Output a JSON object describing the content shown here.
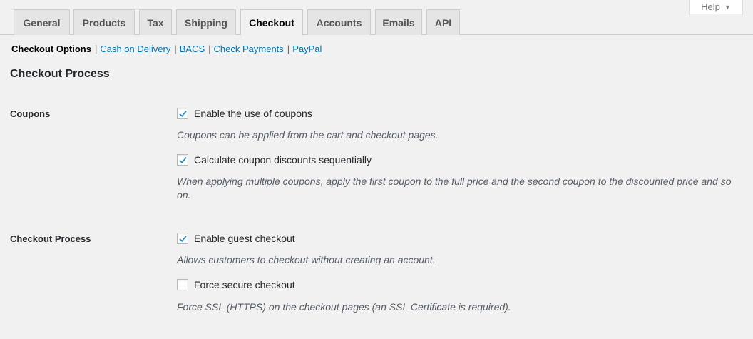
{
  "help": {
    "label": "Help",
    "caret": "▼"
  },
  "tabs": [
    {
      "label": "General"
    },
    {
      "label": "Products"
    },
    {
      "label": "Tax"
    },
    {
      "label": "Shipping"
    },
    {
      "label": "Checkout",
      "active": true
    },
    {
      "label": "Accounts"
    },
    {
      "label": "Emails"
    },
    {
      "label": "API"
    }
  ],
  "subnav": {
    "current": "Checkout Options",
    "links": [
      "Cash on Delivery",
      "BACS",
      "Check Payments",
      "PayPal"
    ],
    "separator": "|"
  },
  "section_title": "Checkout Process",
  "coupons": {
    "label": "Coupons",
    "options": [
      {
        "label": "Enable the use of coupons",
        "checked": true,
        "description": "Coupons can be applied from the cart and checkout pages."
      },
      {
        "label": "Calculate coupon discounts sequentially",
        "checked": true,
        "description": "When applying multiple coupons, apply the first coupon to the full price and the second coupon to the discounted price and so on."
      }
    ]
  },
  "checkout_process": {
    "label": "Checkout Process",
    "options": [
      {
        "label": "Enable guest checkout",
        "checked": true,
        "description": "Allows customers to checkout without creating an account."
      },
      {
        "label": "Force secure checkout",
        "checked": false,
        "description": "Force SSL (HTTPS) on the checkout pages (an SSL Certificate is required)."
      }
    ]
  },
  "colors": {
    "link": "#0073aa",
    "check": "#1e8cbe",
    "background": "#f1f1f1"
  }
}
